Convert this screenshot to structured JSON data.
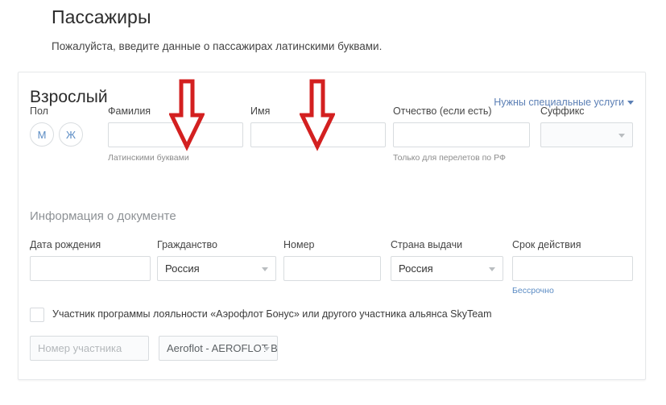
{
  "header": {
    "title": "Пассажиры",
    "subtitle": "Пожалуйста, введите данные о пассажирах латинскими буквами."
  },
  "card": {
    "title": "Взрослый",
    "special_services_link": "Нужны специальные услуги"
  },
  "name_row": {
    "gender": {
      "label": "Пол",
      "male": "М",
      "female": "Ж"
    },
    "lastname": {
      "label": "Фамилия",
      "value": "",
      "hint": "Латинскими буквами"
    },
    "firstname": {
      "label": "Имя",
      "value": ""
    },
    "middlename": {
      "label": "Отчество (если есть)",
      "value": "",
      "hint": "Только для перелетов по РФ"
    },
    "suffix": {
      "label": "Суффикс",
      "value": ""
    }
  },
  "document": {
    "section_title": "Информация о документе",
    "birthdate": {
      "label": "Дата рождения",
      "value": ""
    },
    "citizenship": {
      "label": "Гражданство",
      "value": "Россия"
    },
    "number": {
      "label": "Номер",
      "value": ""
    },
    "issue_country": {
      "label": "Страна выдачи",
      "value": "Россия"
    },
    "expiry": {
      "label": "Срок действия",
      "value": "",
      "hint": "Бессрочно"
    }
  },
  "loyalty": {
    "checkbox_label": "Участник программы лояльности «Аэрофлот Бонус» или другого участника альянса SkyTeam",
    "checked": false,
    "member_number": {
      "value": "",
      "placeholder": "Номер участника"
    },
    "program": {
      "value": "Aeroflot - AEROFLOT BONUS"
    }
  },
  "annotations": {
    "arrow_color": "#d32020",
    "arrow_lastname": "arrow-down-lastname",
    "arrow_firstname": "arrow-down-firstname"
  },
  "colors": {
    "accent": "#5b8cc4",
    "border": "#d8dcdf",
    "muted_text": "#8c8c8c"
  }
}
